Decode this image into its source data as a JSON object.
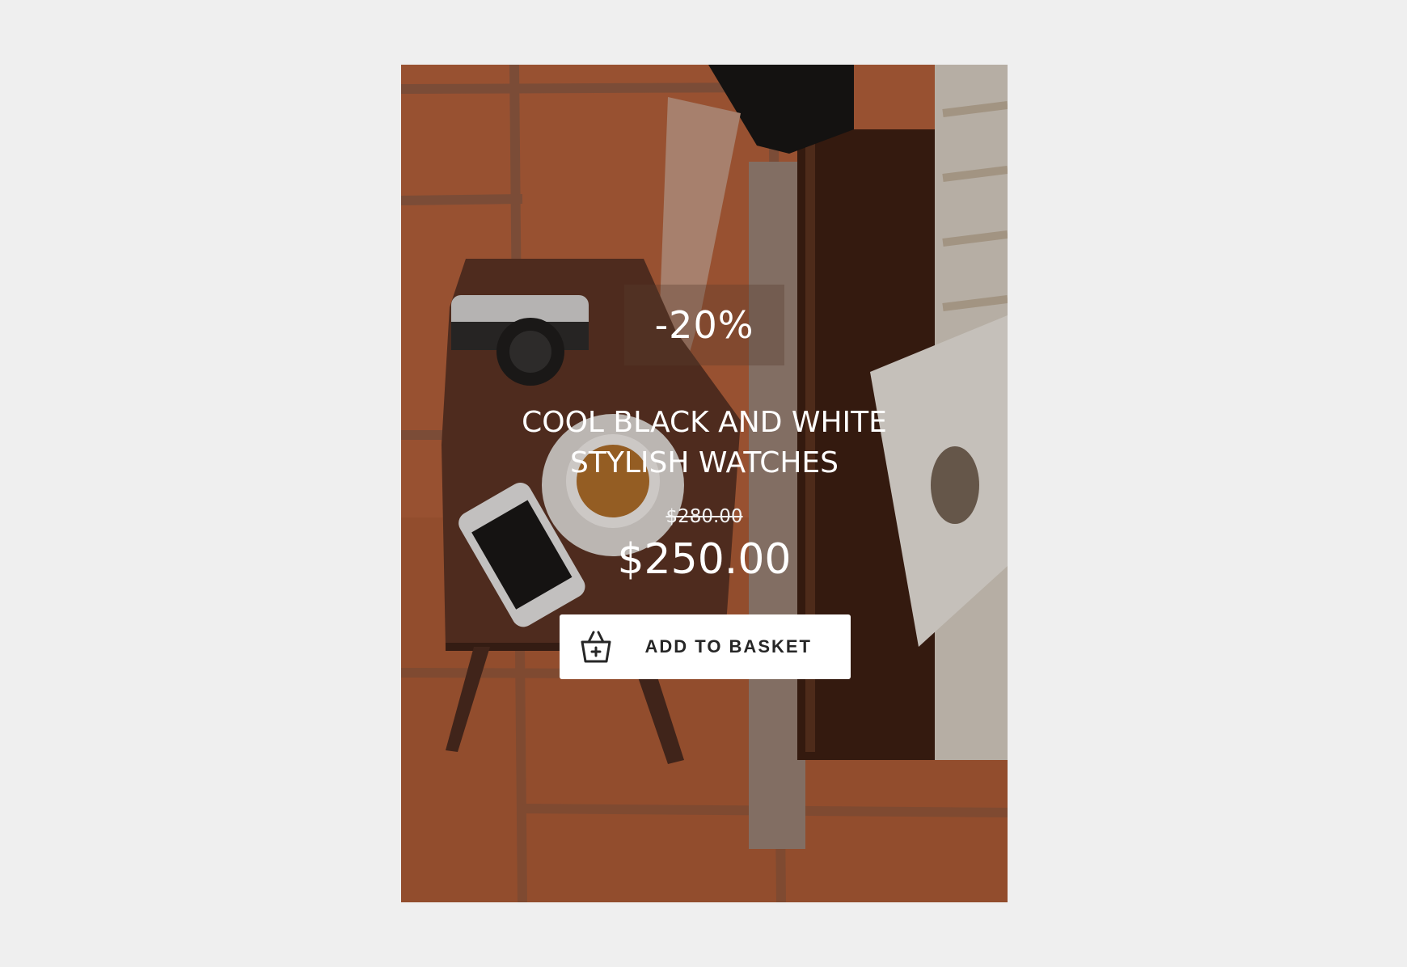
{
  "product": {
    "discount": "-20%",
    "title": "COOL BLACK AND WHITE STYLISH WATCHES",
    "old_price": "$280.00",
    "new_price": "$250.00"
  },
  "actions": {
    "add_to_basket_label": "ADD TO BASKET",
    "add_to_basket_icon": "basket-add-icon"
  },
  "colors": {
    "page_background": "#efefef",
    "button_background": "#ffffff",
    "button_text": "#262626",
    "overlay_text": "#ffffff"
  }
}
